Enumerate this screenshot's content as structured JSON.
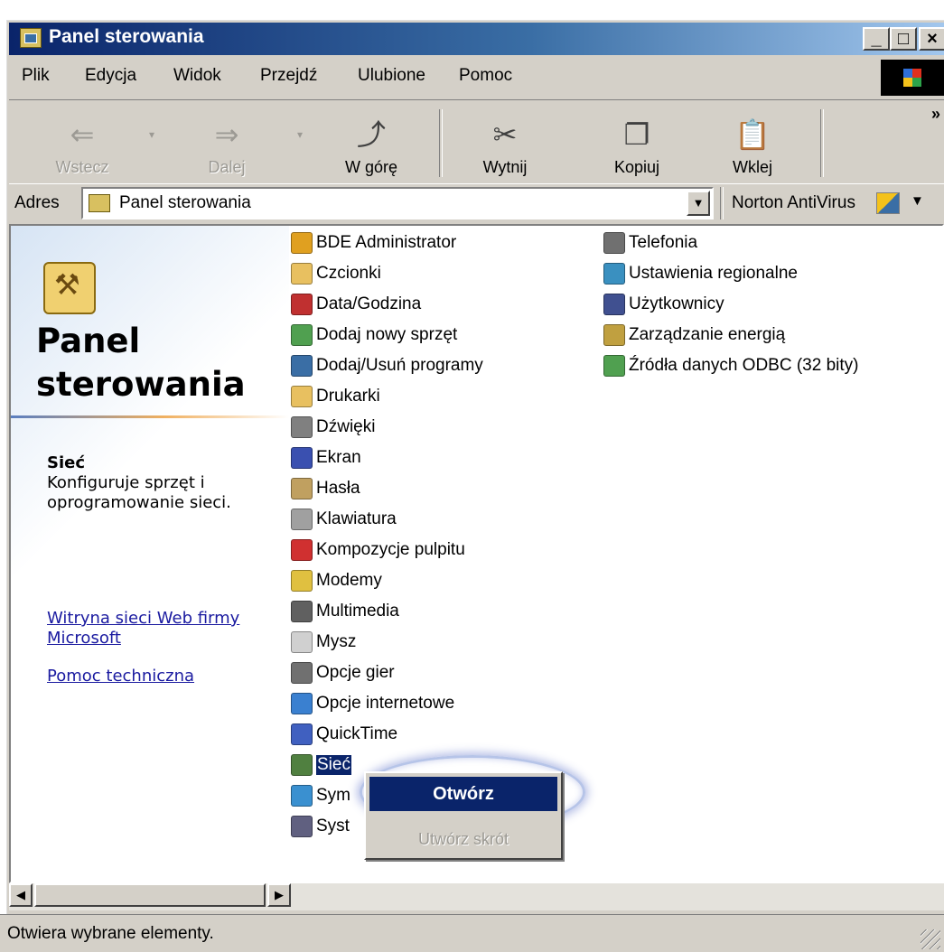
{
  "window": {
    "title": "Panel sterowania"
  },
  "title_buttons": [
    "_",
    "□",
    "×"
  ],
  "menu": [
    {
      "label": "Plik"
    },
    {
      "label": "Edycja"
    },
    {
      "label": "Widok"
    },
    {
      "label": "Przejdź"
    },
    {
      "label": "Ulubione"
    },
    {
      "label": "Pomoc"
    }
  ],
  "toolbar": {
    "back": "Wstecz",
    "forward": "Dalej",
    "up": "W górę",
    "cut": "Wytnij",
    "copy": "Kopiuj",
    "paste": "Wklej",
    "more": "»"
  },
  "address": {
    "label": "Adres",
    "value": "Panel sterowania",
    "norton": "Norton AntiVirus"
  },
  "left_panel": {
    "title": "Panel sterowania",
    "selected_name": "Sieć",
    "selected_desc": "Konfiguruje sprzęt i oprogramowanie sieci.",
    "link1": "Witryna sieci Web firmy Microsoft",
    "link2": "Pomoc techniczna"
  },
  "items_col1": [
    {
      "label": "BDE Administrator",
      "icon": "bde-icon",
      "color": "#e0a020"
    },
    {
      "label": "Czcionki",
      "icon": "fonts-icon",
      "color": "#e8c060"
    },
    {
      "label": "Data/Godzina",
      "icon": "calendar-icon",
      "color": "#c03030"
    },
    {
      "label": "Dodaj nowy sprzęt",
      "icon": "hardware-icon",
      "color": "#50a050"
    },
    {
      "label": "Dodaj/Usuń programy",
      "icon": "programs-icon",
      "color": "#3a6ea5"
    },
    {
      "label": "Drukarki",
      "icon": "printer-icon",
      "color": "#e8c060"
    },
    {
      "label": "Dźwięki",
      "icon": "speaker-icon",
      "color": "#808080"
    },
    {
      "label": "Ekran",
      "icon": "display-icon",
      "color": "#3a50b0"
    },
    {
      "label": "Hasła",
      "icon": "keys-icon",
      "color": "#c0a060"
    },
    {
      "label": "Klawiatura",
      "icon": "keyboard-icon",
      "color": "#a0a0a0"
    },
    {
      "label": "Kompozycje pulpitu",
      "icon": "themes-icon",
      "color": "#d03030"
    },
    {
      "label": "Modemy",
      "icon": "modem-icon",
      "color": "#e0c040"
    },
    {
      "label": "Multimedia",
      "icon": "multimedia-icon",
      "color": "#606060"
    },
    {
      "label": "Mysz",
      "icon": "mouse-icon",
      "color": "#d0d0d0"
    },
    {
      "label": "Opcje gier",
      "icon": "joystick-icon",
      "color": "#707070"
    },
    {
      "label": "Opcje internetowe",
      "icon": "internet-icon",
      "color": "#3a80d0"
    },
    {
      "label": "QuickTime",
      "icon": "quicktime-icon",
      "color": "#4060c0"
    },
    {
      "label": "Sieć",
      "icon": "network-icon",
      "color": "#508040"
    },
    {
      "label": "Sym",
      "icon": "symantec-icon",
      "color": "#3a90d0"
    },
    {
      "label": "Syst",
      "icon": "system-icon",
      "color": "#606080"
    }
  ],
  "items_col2": [
    {
      "label": "Telefonia",
      "icon": "telephony-icon",
      "color": "#707070"
    },
    {
      "label": "Ustawienia regionalne",
      "icon": "globe-icon",
      "color": "#3a90c0"
    },
    {
      "label": "Użytkownicy",
      "icon": "users-icon",
      "color": "#405090"
    },
    {
      "label": "Zarządzanie energią",
      "icon": "power-icon",
      "color": "#c0a040"
    },
    {
      "label": "Źródła danych ODBC (32 bity)",
      "icon": "odbc-icon",
      "color": "#50a050"
    }
  ],
  "context_menu": {
    "open": "Otwórz",
    "shortcut": "Utwórz skrót"
  },
  "scrollbar": {
    "left_arrow": "◀",
    "right_arrow": "▶"
  },
  "status": {
    "text": "Otwiera wybrane elementy."
  }
}
